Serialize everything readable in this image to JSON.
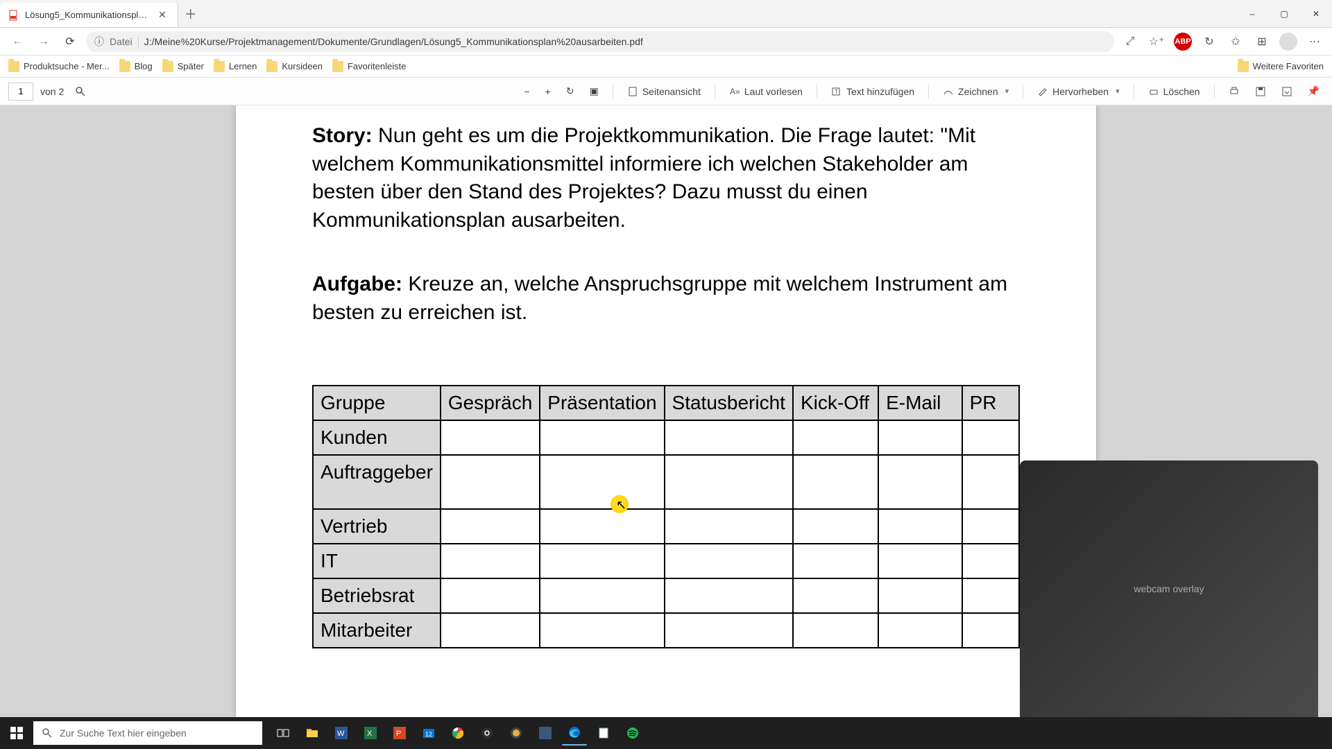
{
  "window": {
    "tab_title": "Lösung5_Kommunikationsplan a",
    "minimize": "–",
    "maximize": "▢",
    "close": "✕"
  },
  "address": {
    "info_icon": "ⓘ",
    "protocol_label": "Datei",
    "path": "J:/Meine%20Kurse/Projektmanagement/Dokumente/Grundlagen/Lösung5_Kommunikationsplan%20ausarbeiten.pdf",
    "abp_badge": "ABP"
  },
  "bookmarks": {
    "items": [
      "Produktsuche - Mer...",
      "Blog",
      "Später",
      "Lernen",
      "Kursideen",
      "Favoritenleiste"
    ],
    "overflow_label": "Weitere Favoriten"
  },
  "pdfbar": {
    "page": "1",
    "page_total_prefix": "von",
    "page_total": "2",
    "toc": "Seitenansicht",
    "read_aloud": "Laut vorlesen",
    "add_text": "Text hinzufügen",
    "draw": "Zeichnen",
    "highlight": "Hervorheben",
    "erase": "Löschen"
  },
  "doc": {
    "story_label": "Story:",
    "story_text": "Nun geht es um die Projektkommunikation. Die Frage lautet: \"Mit welchem Kommunikationsmittel informiere ich welchen Stakeholder am besten über den Stand des Projektes? Dazu musst du einen Kommunikationsplan ausarbeiten.",
    "task_label": "Aufgabe:",
    "task_text": "Kreuze an, welche Anspruchsgruppe mit welchem Instrument am besten zu erreichen ist.",
    "table": {
      "headers": [
        "Gruppe",
        "Gespräch",
        "Präsentation",
        "Statusbericht",
        "Kick-Off",
        "E-Mail",
        "PR"
      ],
      "rows": [
        "Kunden",
        "Auftraggeber",
        "Vertrieb",
        "IT",
        "Betriebsrat",
        "Mitarbeiter"
      ]
    }
  },
  "webcam": {
    "placeholder": "webcam overlay"
  },
  "taskbar": {
    "search_placeholder": "Zur Suche Text hier eingeben"
  }
}
